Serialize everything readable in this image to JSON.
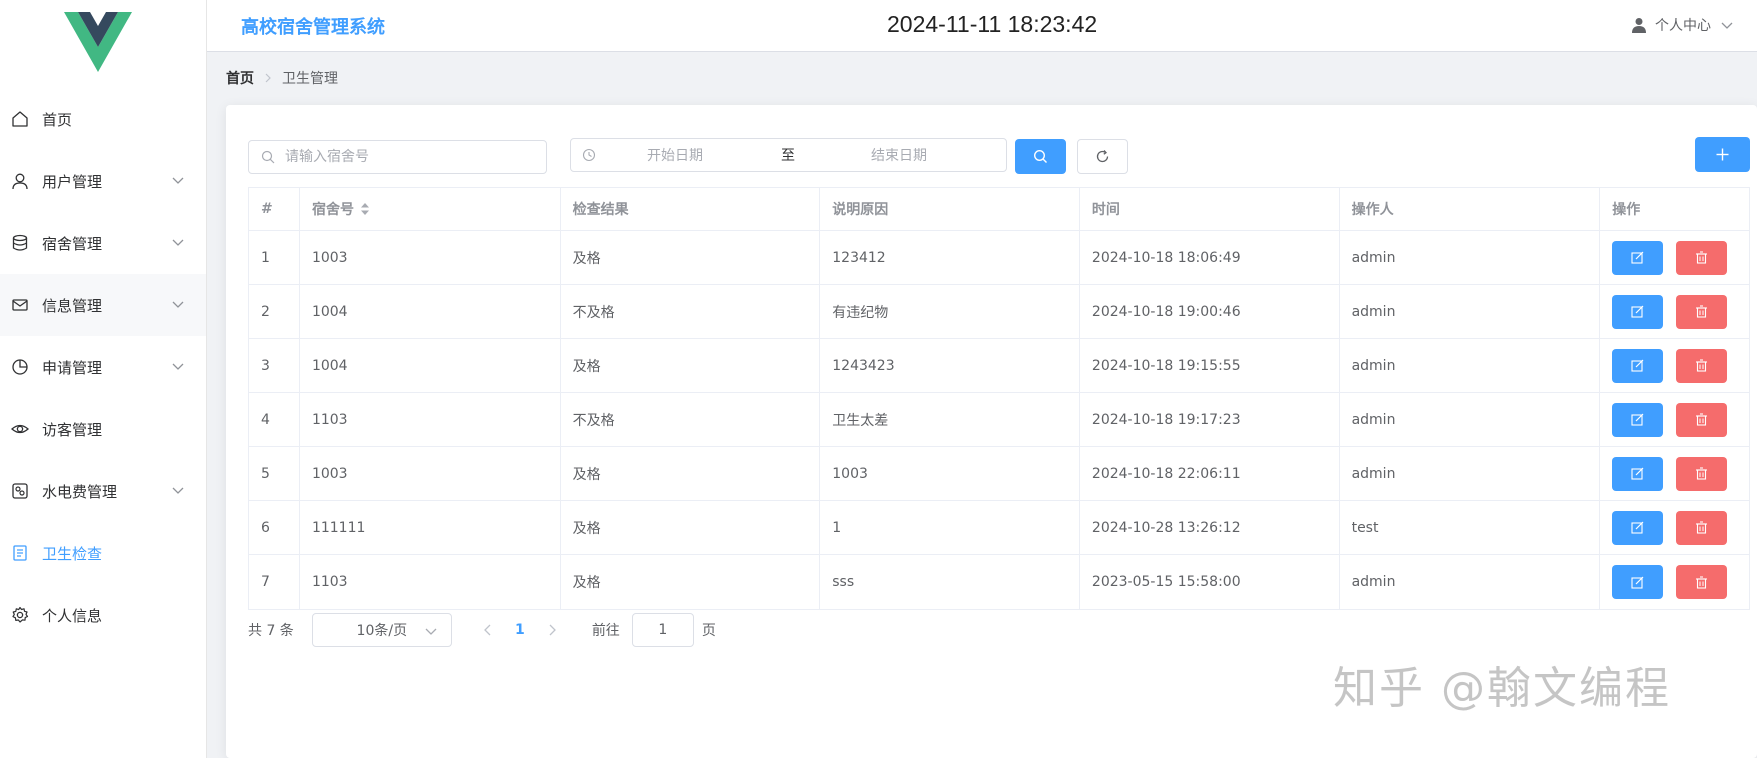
{
  "app": {
    "title": "高校宿舍管理系统",
    "datetime": "2024-11-11 18:23:42"
  },
  "user_menu": {
    "label": "个人中心"
  },
  "sidebar": {
    "items": [
      {
        "label": "首页",
        "icon": "home-icon",
        "has_children": false,
        "active": false
      },
      {
        "label": "用户管理",
        "icon": "user-icon",
        "has_children": true,
        "active": false
      },
      {
        "label": "宿舍管理",
        "icon": "database-icon",
        "has_children": true,
        "active": false
      },
      {
        "label": "信息管理",
        "icon": "message-icon",
        "has_children": true,
        "active": false
      },
      {
        "label": "申请管理",
        "icon": "pie-chart-icon",
        "has_children": true,
        "active": false
      },
      {
        "label": "访客管理",
        "icon": "eye-icon",
        "has_children": false,
        "active": false
      },
      {
        "label": "水电费管理",
        "icon": "meter-icon",
        "has_children": true,
        "active": false
      },
      {
        "label": "卫生检查",
        "icon": "document-icon",
        "has_children": false,
        "active": true
      },
      {
        "label": "个人信息",
        "icon": "settings-icon",
        "has_children": false,
        "active": false
      }
    ]
  },
  "breadcrumb": {
    "home": "首页",
    "current": "卫生管理"
  },
  "toolbar": {
    "search_placeholder": "请输入宿舍号",
    "date_start_placeholder": "开始日期",
    "date_separator": "至",
    "date_end_placeholder": "结束日期"
  },
  "table": {
    "columns": [
      "#",
      "宿舍号",
      "检查结果",
      "说明原因",
      "时间",
      "操作人",
      "操作"
    ],
    "rows": [
      {
        "index": "1",
        "room": "1003",
        "result": "及格",
        "reason": "123412",
        "time": "2024-10-18 18:06:49",
        "operator": "admin"
      },
      {
        "index": "2",
        "room": "1004",
        "result": "不及格",
        "reason": "有违纪物",
        "time": "2024-10-18 19:00:46",
        "operator": "admin"
      },
      {
        "index": "3",
        "room": "1004",
        "result": "及格",
        "reason": "1243423",
        "time": "2024-10-18 19:15:55",
        "operator": "admin"
      },
      {
        "index": "4",
        "room": "1103",
        "result": "不及格",
        "reason": "卫生太差",
        "time": "2024-10-18 19:17:23",
        "operator": "admin"
      },
      {
        "index": "5",
        "room": "1003",
        "result": "及格",
        "reason": "1003",
        "time": "2024-10-18 22:06:11",
        "operator": "admin"
      },
      {
        "index": "6",
        "room": "111111",
        "result": "及格",
        "reason": "1",
        "time": "2024-10-28 13:26:12",
        "operator": "test"
      },
      {
        "index": "7",
        "room": "1103",
        "result": "及格",
        "reason": "sss",
        "time": "2023-05-15 15:58:00",
        "operator": "admin"
      }
    ]
  },
  "pagination": {
    "total_text": "共 7 条",
    "page_size": "10条/页",
    "current_page": "1",
    "goto_label": "前往",
    "goto_value": "1",
    "page_unit": "页"
  },
  "watermark": "知乎 @翰文编程",
  "colors": {
    "primary": "#409eff",
    "danger": "#f56c6c",
    "logo_green": "#41b883",
    "logo_dark": "#35495e"
  }
}
